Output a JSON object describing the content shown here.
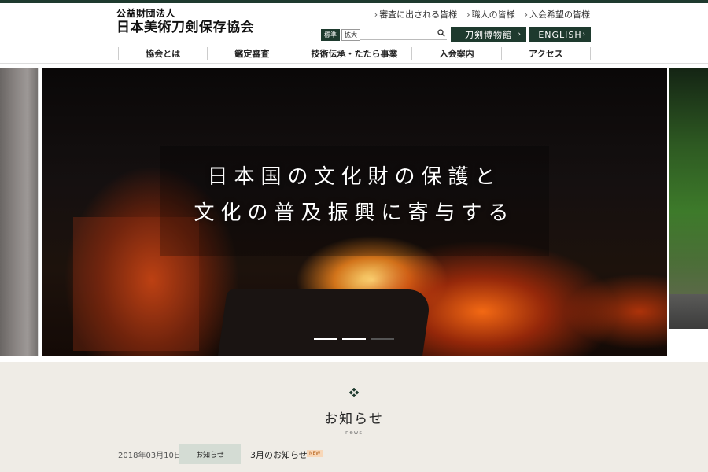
{
  "header": {
    "logo_sub": "公益財団法人",
    "logo_main": "日本美術刀剣保存協会",
    "top_links": [
      {
        "label": "審査に出される皆様"
      },
      {
        "label": "職人の皆様"
      },
      {
        "label": "入会希望の皆様"
      }
    ],
    "size_standard": "標準",
    "size_large": "拡大",
    "search_placeholder": "",
    "museum_label": "刀剣博物館",
    "english_label": "ENGLISH"
  },
  "nav": {
    "items": [
      {
        "label": "協会とは"
      },
      {
        "label": "鑑定審査"
      },
      {
        "label": "技術伝承・たたら事業"
      },
      {
        "label": "入会案内"
      },
      {
        "label": "アクセス"
      }
    ]
  },
  "hero": {
    "line1": "日本国の文化財の保護と",
    "line2": "文化の普及振興に寄与する",
    "slides_total": 3,
    "active_slide": 1
  },
  "news": {
    "title": "お知らせ",
    "subtitle": "news",
    "items": [
      {
        "date": "2018年03月10日",
        "category": "お知らせ",
        "text": "3月のお知らせ",
        "badge": "NEW"
      }
    ]
  },
  "colors": {
    "brand_dark": "#1e3a2e",
    "news_bg": "#efece6",
    "category_bg": "#d4dcd4"
  }
}
